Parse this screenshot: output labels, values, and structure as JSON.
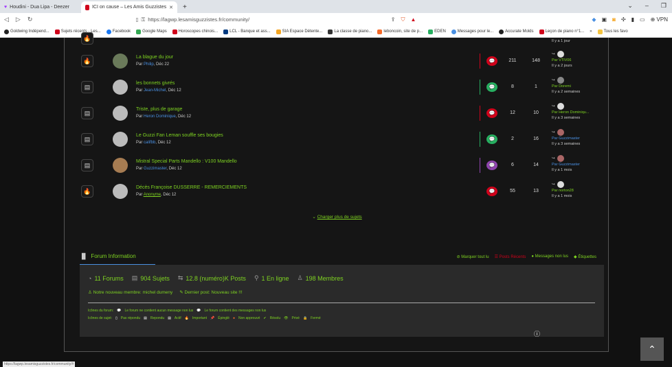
{
  "browser": {
    "tabs": [
      {
        "label": "Houdini - Dua Lipa - Deezer",
        "active": false
      },
      {
        "label": "ICI on cause – Les Amis Guzzistes",
        "active": true
      }
    ],
    "url": "https://lagwp.lesamisguzzistes.fr/community/",
    "vpn": "VPN",
    "bookmarks": [
      "Goldwing Indépend...",
      "Sujets récents - Les...",
      "Facebook",
      "Google Maps",
      "Horoscopes chinois...",
      "LCL - Banque et ass...",
      "SIA Espace Détente...",
      "La classe de piano...",
      "leboncoin, site de p...",
      "EDEN",
      "Messages pour le...",
      "Accurate Molds",
      "Leçon de piano n°1...",
      "»",
      "Tous les favo"
    ]
  },
  "topics": [
    {
      "title": "La blague du jour",
      "by_prefix": "Par",
      "author": "Philip",
      "date": ", Déc 22",
      "type": "hot",
      "replies": "211",
      "views": "148",
      "last_by": "Par VTIV06",
      "last_time": "Il y a 2 jours",
      "bar": "#d0021b",
      "bubble": "#d0021b"
    },
    {
      "title": "les bonnets givrés",
      "by_prefix": "Par",
      "author": "Jean-Michel",
      "date": ", Déc 12",
      "type": "doc",
      "replies": "8",
      "views": "1",
      "last_by": "Par Doremi",
      "last_time": "Il y a 2 semaines",
      "bar": "#27ae60",
      "bubble": "#27ae60"
    },
    {
      "title": "Triste, plus de garage",
      "by_prefix": "Par",
      "author": "Heron Dominique",
      "date": ", Déc 12",
      "type": "doc",
      "replies": "12",
      "views": "10",
      "last_by": "Par Heron Dominiqu...",
      "last_time": "Il y a 3 semaines",
      "bar": "#d0021b",
      "bubble": "#d0021b"
    },
    {
      "title": "Le Guzzi Fan Leman souffle ses bougies",
      "by_prefix": "Par",
      "author": "califbb",
      "date": ", Déc 12",
      "type": "doc",
      "replies": "2",
      "views": "16",
      "last_by": "Par Guzzimaster",
      "last_time": "Il y a 3 semaines",
      "bar": "#27ae60",
      "bubble": "#27ae60"
    },
    {
      "title": "Mistral Special Parts Mandello : V100 Mandello",
      "by_prefix": "Par",
      "author": "Guzzimaster",
      "date": ", Déc 12",
      "type": "doc",
      "replies": "6",
      "views": "14",
      "last_by": "Par Guzzimaster",
      "last_time": "Il y a 1 mois",
      "bar": "#8e44ad",
      "bubble": "#8e44ad"
    },
    {
      "title": "Décès Françoise DUSSERRE - REMERCIEMENTS",
      "by_prefix": "Par",
      "author": "Anonyme",
      "date": ", Déc 12",
      "type": "hot",
      "replies": "55",
      "views": "13",
      "last_by": "Par norton28",
      "last_time": "Il y a 1 mois",
      "bar": "#d0021b",
      "bubble": "#d0021b"
    }
  ],
  "top_partial": "Il y a 1 jour",
  "load_more": "Charger plus de sujets",
  "forum_info": {
    "title": "Forum Information",
    "actions": {
      "mark_read": "Marquer tout lu",
      "recent": "Posts Récents",
      "unread": "Messages non lus",
      "tags": "Étiquettes"
    },
    "stats": {
      "forums": "11 Forums",
      "topics": "904 Sujets",
      "posts": "12.8 (numéro)K Posts",
      "online": "1 En ligne",
      "members": "198 Membres"
    },
    "new_member": "Notre nouveau membre: michel dumeny",
    "last_post": "Dernier post: Nouveau site !!!",
    "legend_forum_label": "Icônes du forum:",
    "legend_forum_no": "Le forum ne contient aucun message non lus",
    "legend_forum_yes": "Le forum contient des messages non lus",
    "legend_topic_label": "Icônes de sujet:",
    "legend_topic": [
      "Pas répondu",
      "Repondu",
      "Actif",
      "Important",
      "Épinglé",
      "Non approuvé",
      "Résolu",
      "Privé",
      "Fermé"
    ]
  },
  "status_url": "https://lagwp.lesamisguzzistes.fr/community/#"
}
